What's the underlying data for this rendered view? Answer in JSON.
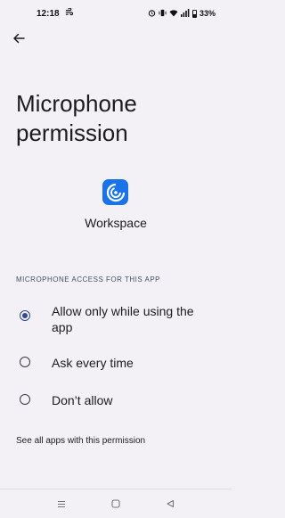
{
  "status_bar": {
    "time": "12:18",
    "battery_percent": "33%",
    "icons": [
      "wind-icon",
      "alarm-icon",
      "vibrate-icon",
      "wifi-icon",
      "signal-icon",
      "battery-icon"
    ]
  },
  "header": {
    "back_icon": "arrow-back-icon"
  },
  "page": {
    "title": "Microphone permission",
    "app_name": "Workspace",
    "app_icon": "workspace-app-icon",
    "accent_color": "#1a73e8"
  },
  "section": {
    "header": "MICROPHONE ACCESS FOR THIS APP",
    "options": [
      {
        "label": "Allow only while using the app",
        "selected": true
      },
      {
        "label": "Ask every time",
        "selected": false
      },
      {
        "label": "Don’t allow",
        "selected": false
      }
    ]
  },
  "links": {
    "see_all": "See all apps with this permission"
  },
  "nav_bar": {
    "icons": [
      "recents-icon",
      "home-icon",
      "back-triangle-icon"
    ]
  }
}
